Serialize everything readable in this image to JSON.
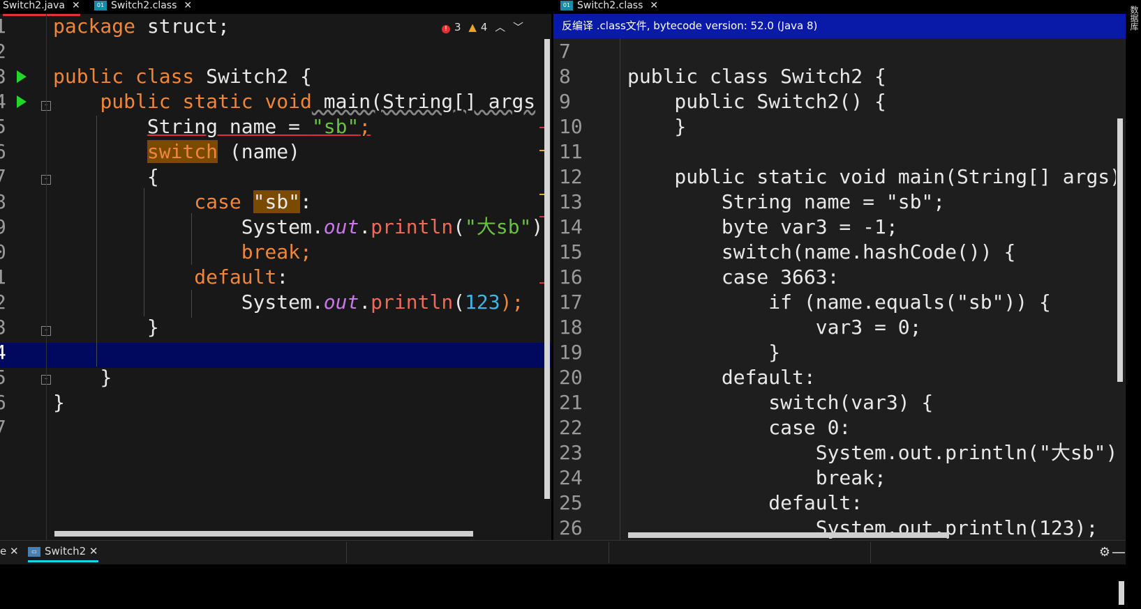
{
  "left_editor": {
    "tabs": [
      {
        "label": "Switch2.java",
        "close": "✕"
      },
      {
        "label": "Switch2.class",
        "close": "✕"
      }
    ],
    "inspection": {
      "errors": "3",
      "warnings": "4",
      "up": "^",
      "down": "v"
    },
    "line_numbers": [
      "1",
      "2",
      "3",
      "4",
      "5",
      "6",
      "7",
      "8",
      "9",
      "0",
      "1",
      "2",
      "3",
      "4",
      "5",
      "6",
      "7"
    ],
    "lines": {
      "l1_kw": "package",
      "l1_rest": " struct;",
      "l3_kw": "public class",
      "l3_rest": " Switch2 {",
      "l4_kw": "public static void",
      "l4_rest": " main(String[] args",
      "l5_a": "String name = ",
      "l5_str": "\"sb\"",
      "l5_b": ";",
      "l6_kw": "switch",
      "l6_rest": " (name)",
      "l7": "{",
      "l8_kw": "case",
      "l8_str": "\"sb\"",
      "l8_rest": ":",
      "l9_a": "System.",
      "l9_fld": "out",
      "l9_dot": ".",
      "l9_mth": "println",
      "l9_open": "(",
      "l9_str": "\"大sb\"",
      "l9_close": ")",
      "l10_kw": "break;",
      "l11_kw": "default",
      "l11_rest": ":",
      "l12_a": "System.",
      "l12_fld": "out",
      "l12_dot": ".",
      "l12_mth": "println",
      "l12_open": "(",
      "l12_num": "123",
      "l12_close": ");",
      "l13": "}",
      "l15": "}",
      "l16": "}"
    }
  },
  "right_editor": {
    "tab": {
      "label": "Switch2.class",
      "close": "✕"
    },
    "banner": "反编译 .class文件, bytecode version: 52.0 (Java 8)",
    "line_numbers": [
      "7",
      "8",
      "9",
      "10",
      "11",
      "12",
      "13",
      "14",
      "15",
      "16",
      "17",
      "18",
      "19",
      "20",
      "21",
      "22",
      "23",
      "24",
      "25",
      "26"
    ],
    "code_lines": [
      "",
      "public class Switch2 {",
      "    public Switch2() {",
      "    }",
      "",
      "    public static void main(String[] args)",
      "        String name = \"sb\";",
      "        byte var3 = -1;",
      "        switch(name.hashCode()) {",
      "        case 3663:",
      "            if (name.equals(\"sb\")) {",
      "                var3 = 0;",
      "            }",
      "        default:",
      "            switch(var3) {",
      "            case 0:",
      "                System.out.println(\"大sb\")",
      "                break;",
      "            default:",
      "                System.out.println(123);"
    ]
  },
  "bottom_panel": {
    "tab_left_fragment": "e",
    "tab_left_close": "✕",
    "run_tab": "Switch2",
    "run_tab_close": "✕",
    "gear": "⚙",
    "minimize": "—"
  },
  "edge_strip": {
    "label": "数据库"
  },
  "colors": {
    "keyword": "#f0863a",
    "string": "#6ac043",
    "field": "#c779e8",
    "method": "#f06a5a",
    "number": "#3fb6e8",
    "caret_line": "#01095e",
    "banner": "#0a1aa8"
  }
}
